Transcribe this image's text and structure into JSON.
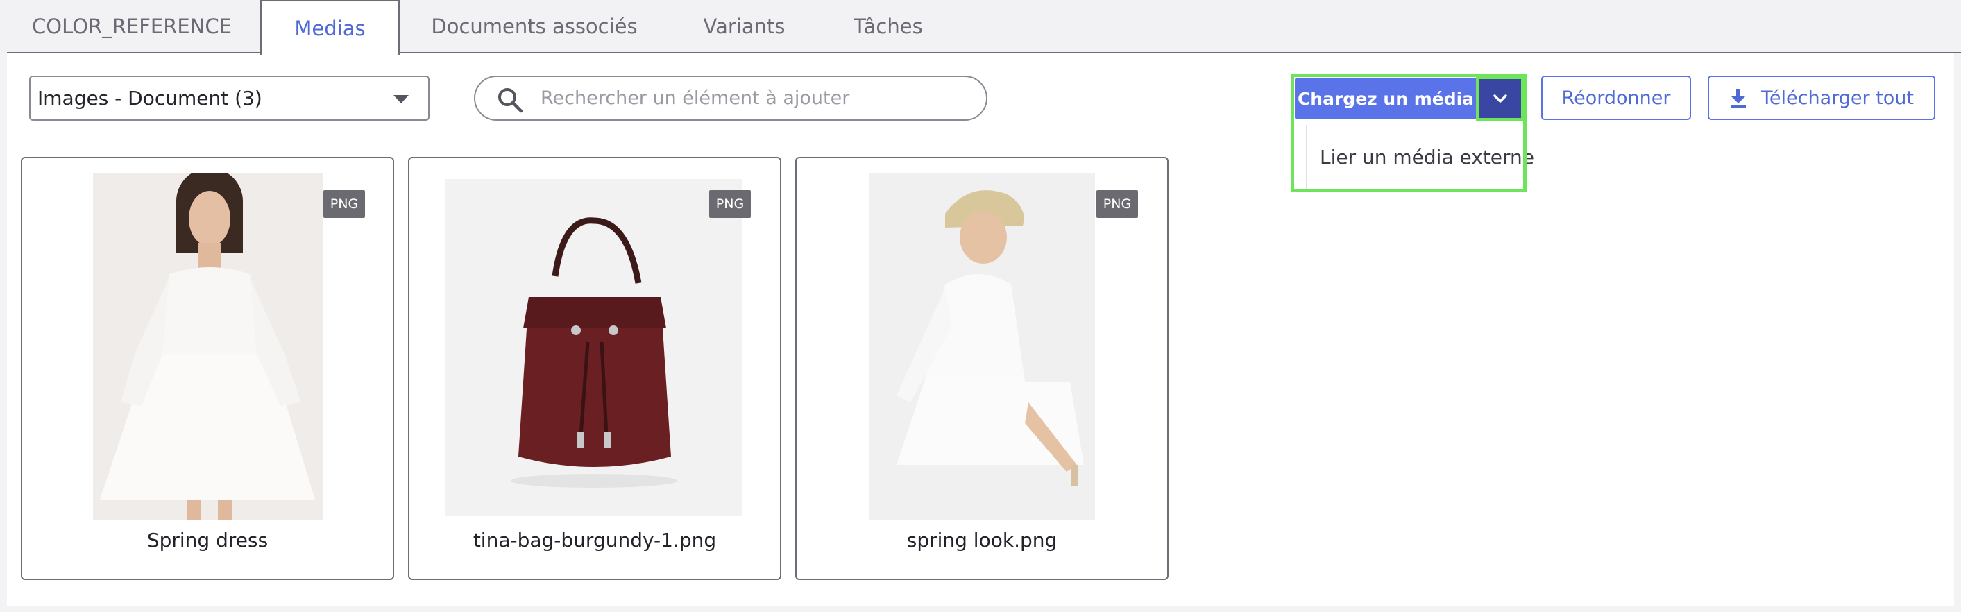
{
  "tabs": [
    {
      "label": "COLOR_REFERENCE",
      "active": false
    },
    {
      "label": "Medias",
      "active": true
    },
    {
      "label": "Documents associés",
      "active": false
    },
    {
      "label": "Variants",
      "active": false
    },
    {
      "label": "Tâches",
      "active": false
    }
  ],
  "filter": {
    "selected": "Images - Document (3)"
  },
  "search": {
    "placeholder": "Rechercher un élément à ajouter",
    "value": ""
  },
  "upload": {
    "button_label": "Chargez un média",
    "menu_items": [
      "Lier un média externe"
    ]
  },
  "actions": {
    "reorder_label": "Réordonner",
    "download_all_label": "Télécharger tout"
  },
  "media": [
    {
      "name": "Spring dress",
      "type": "PNG"
    },
    {
      "name": "tina-bag-burgundy-1.png",
      "type": "PNG"
    },
    {
      "name": "spring look.png",
      "type": "PNG"
    }
  ],
  "colors": {
    "accent": "#5b73e8",
    "accent_dark": "#3946a2",
    "highlight": "#6ee45a",
    "border": "#6d6d77",
    "badge": "#6a6a70"
  }
}
